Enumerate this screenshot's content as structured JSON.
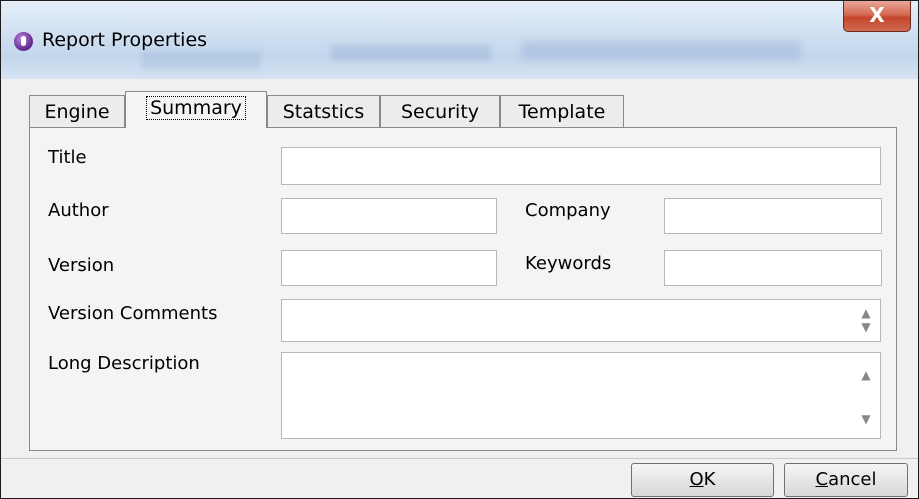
{
  "window": {
    "title": "Report Properties",
    "close_label": "X"
  },
  "tabs": [
    {
      "label": "Engine"
    },
    {
      "label": "Summary"
    },
    {
      "label": "Statstics"
    },
    {
      "label": "Security"
    },
    {
      "label": "Template"
    }
  ],
  "active_tab": "Summary",
  "form": {
    "title_label": "Title",
    "title_value": "",
    "author_label": "Author",
    "author_value": "",
    "company_label": "Company",
    "company_value": "",
    "version_label": "Version",
    "version_value": "",
    "keywords_label": "Keywords",
    "keywords_value": "",
    "version_comments_label": "Version Comments",
    "version_comments_value": "",
    "long_description_label": "Long Description",
    "long_description_value": ""
  },
  "buttons": {
    "ok_mnemonic": "O",
    "ok_rest": "K",
    "cancel_mnemonic": "C",
    "cancel_rest": "ancel"
  },
  "icons": {
    "app": "app-icon",
    "close": "close-icon",
    "scroll_up": "scroll-up-arrow-icon",
    "scroll_down": "scroll-down-arrow-icon"
  },
  "colors": {
    "close_button": "#c4452b",
    "app_icon": "#6b2f97"
  }
}
